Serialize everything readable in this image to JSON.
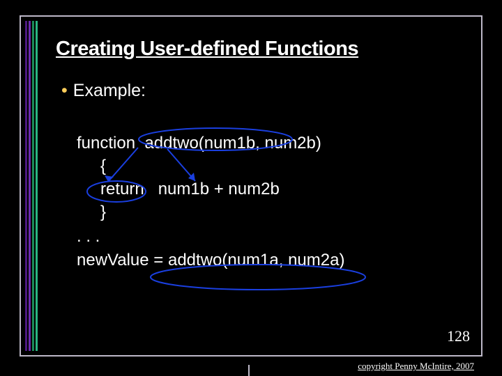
{
  "title": "Creating User-defined Functions",
  "bullet_label": "Example:",
  "code": {
    "l1": "function  addtwo(num1b, num2b)",
    "l2": "{",
    "l3": "return   num1b + num2b",
    "l4": "}",
    "l5": ". . .",
    "l6": "newValue = addtwo(num1a, num2a)"
  },
  "page_number": "128",
  "copyright": "copyright Penny McIntire, 2007"
}
